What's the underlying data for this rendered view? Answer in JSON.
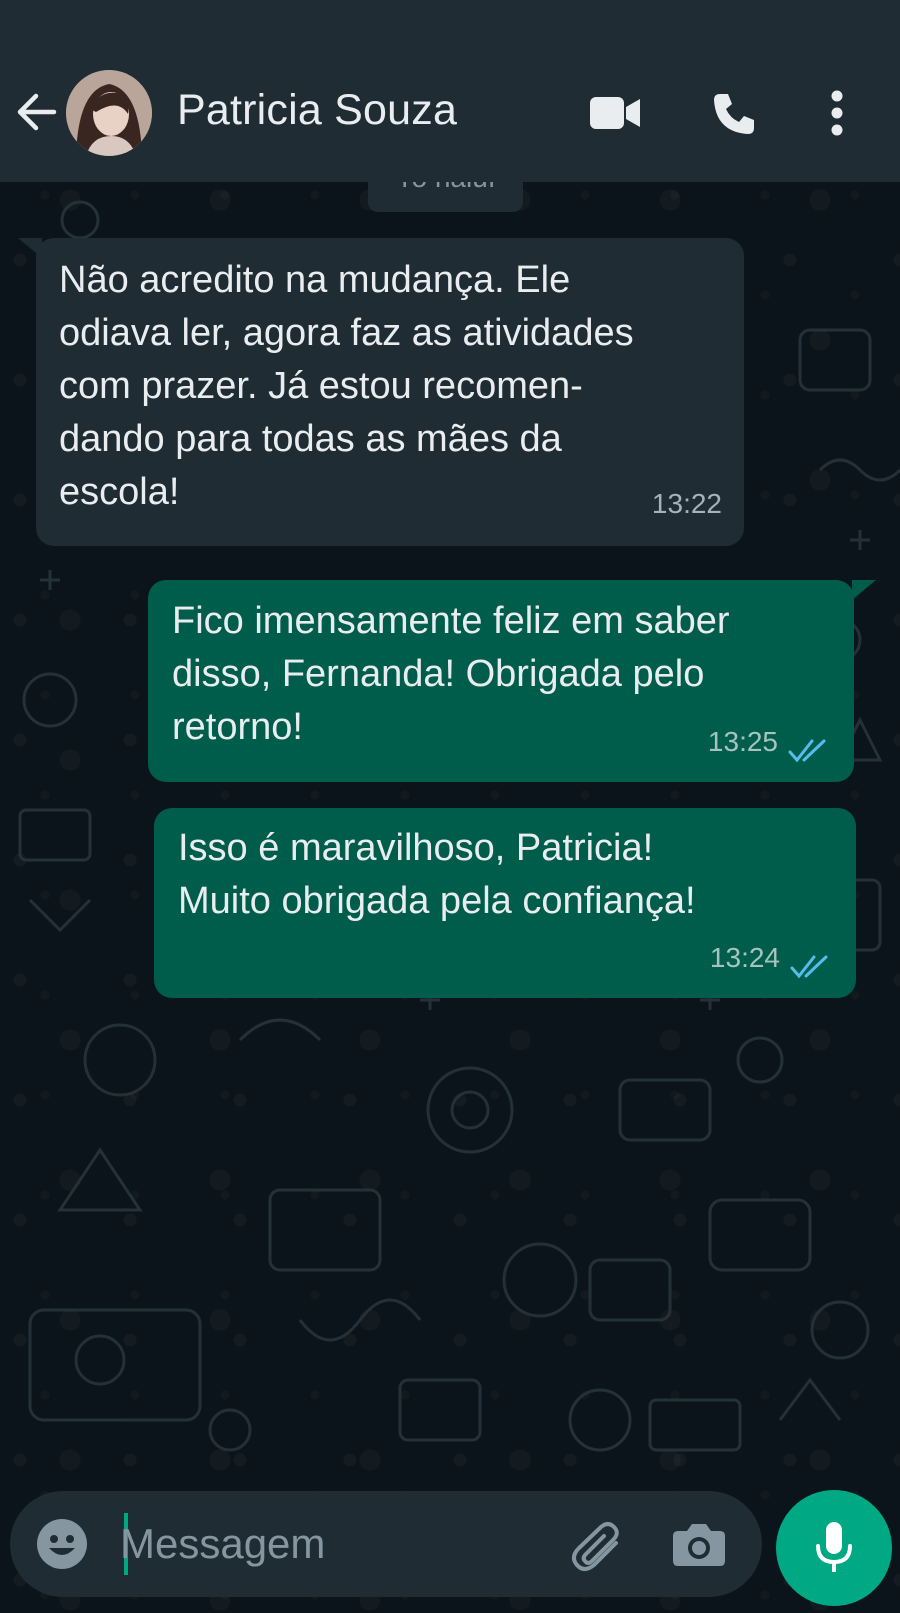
{
  "header": {
    "contact_name": "Patricia Souza",
    "back_icon": "arrow-left-icon",
    "video_icon": "video-call-icon",
    "call_icon": "phone-icon",
    "menu_icon": "more-vertical-icon"
  },
  "date_pill": {
    "label": "Yo ñaluí"
  },
  "messages": [
    {
      "direction": "incoming",
      "text": "Não acredito na mudança. Ele\nodiava ler, agora faz as atividades\ncom prazer. Já estou recomen-\ndando para todas as mães da\nescola!",
      "time": "13:22"
    },
    {
      "direction": "outgoing",
      "text": "Fico imensamente feliz em saber\ndisso, Fernanda! Obrigada pelo\nretorno!",
      "time": "13:25",
      "status": "read"
    },
    {
      "direction": "outgoing",
      "text": "Isso é maravilhoso, Patricia!\nMuito obrigada pela confiança!",
      "time": "13:24",
      "status": "read"
    }
  ],
  "composer": {
    "placeholder": "Messagem",
    "emoji_icon": "emoji-icon",
    "attach_icon": "paperclip-icon",
    "camera_icon": "camera-icon",
    "mic_icon": "microphone-icon"
  },
  "colors": {
    "header_bg": "#1f2c34",
    "chat_bg": "#0b141a",
    "incoming_bubble": "#1f2c34",
    "outgoing_bubble": "#005c4b",
    "accent": "#00a884",
    "read_ticks": "#53bdeb"
  }
}
